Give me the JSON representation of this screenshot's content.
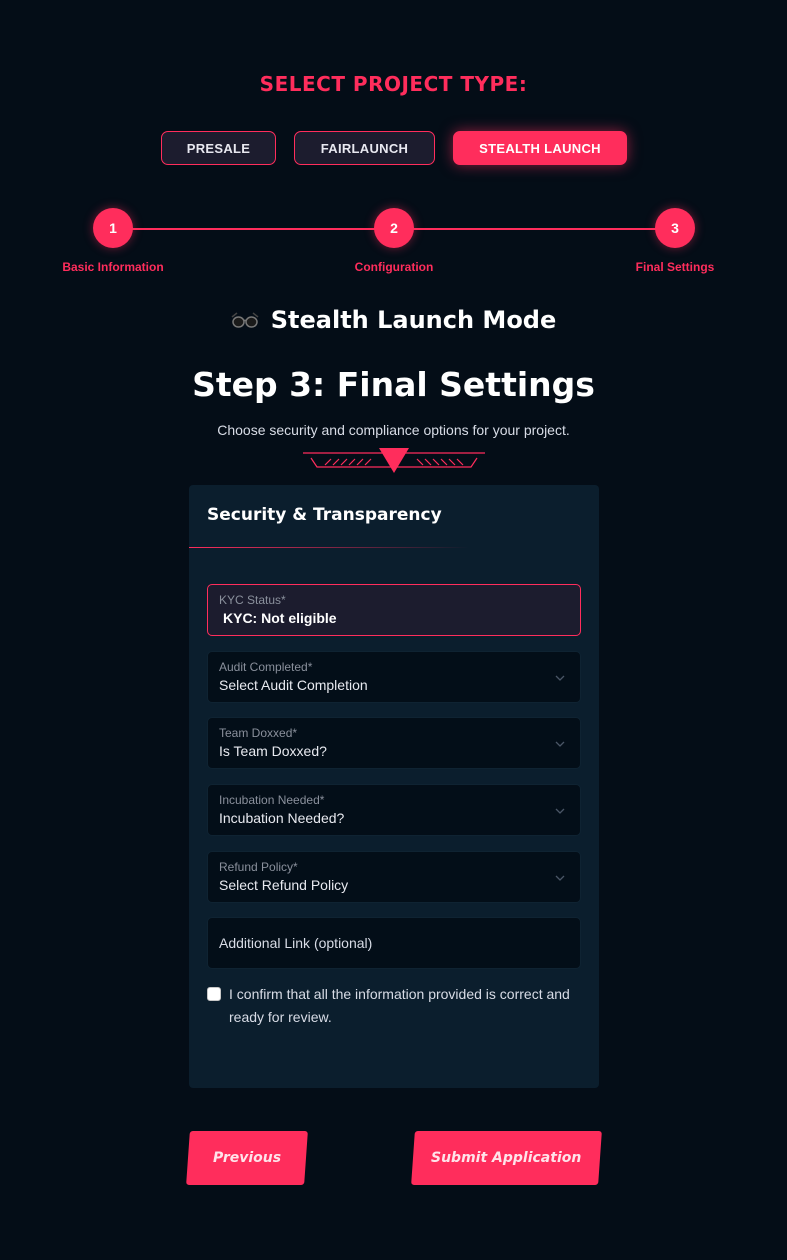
{
  "project_type": {
    "heading": "SELECT PROJECT TYPE:",
    "options": [
      {
        "label": "PRESALE",
        "active": false
      },
      {
        "label": "FAIRLAUNCH",
        "active": false
      },
      {
        "label": "STEALTH LAUNCH",
        "active": true
      }
    ]
  },
  "stepper": {
    "steps": [
      {
        "number": "1",
        "label": "Basic Information"
      },
      {
        "number": "2",
        "label": "Configuration"
      },
      {
        "number": "3",
        "label": "Final Settings"
      }
    ]
  },
  "mode": {
    "icon": "glasses-icon",
    "title": "Stealth Launch Mode"
  },
  "step": {
    "title": "Step 3: Final Settings",
    "subtitle": "Choose security and compliance options for your project."
  },
  "card": {
    "title": "Security & Transparency",
    "kyc": {
      "label": "KYC Status*",
      "value": "KYC: Not eligible"
    },
    "fields": [
      {
        "label": "Audit Completed*",
        "value": "Select Audit Completion"
      },
      {
        "label": "Team Doxxed*",
        "value": "Is Team Doxxed?"
      },
      {
        "label": "Incubation Needed*",
        "value": "Incubation Needed?"
      },
      {
        "label": "Refund Policy*",
        "value": "Select Refund Policy"
      }
    ],
    "additional_link_placeholder": "Additional Link (optional)",
    "confirm_text": "I confirm that all the information provided is correct and ready for review.",
    "confirm_checked": false
  },
  "navigation": {
    "previous_label": "Previous",
    "submit_label": "Submit Application"
  },
  "colors": {
    "accent": "#ff2d5c",
    "background": "#040d17",
    "card": "#0b1e2d"
  }
}
